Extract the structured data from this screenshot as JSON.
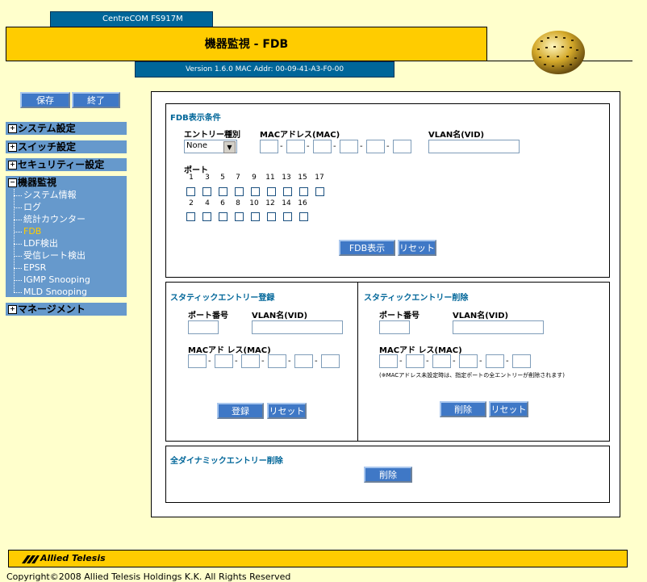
{
  "header": {
    "product_name": "CentreCOM FS917M",
    "page_title": "機器監視 - FDB",
    "version_info": "Version 1.6.0 MAC Addr: 00-09-41-A3-F0-00"
  },
  "toolbar": {
    "save_label": "保存",
    "exit_label": "終了"
  },
  "sidebar": {
    "system": "システム設定",
    "switch": "スイッチ設定",
    "security": "セキュリティー設定",
    "monitor": "機器監視",
    "monitor_items": [
      "システム情報",
      "ログ",
      "統計カウンター",
      "FDB",
      "LDF検出",
      "受信レート検出",
      "EPSR",
      "IGMP Snooping",
      "MLD Snooping"
    ],
    "management": "マネージメント",
    "expand_symbol": "+",
    "collapse_symbol": "−"
  },
  "fdb_filter": {
    "title": "FDB表示条件",
    "entry_type_label": "エントリー種別",
    "entry_type_value": "None",
    "mac_label": "MACアドレス(MAC)",
    "mac_separator": "-",
    "vlan_label": "VLAN名(VID)",
    "port_label": "ポート",
    "ports_odd": [
      "1",
      "3",
      "5",
      "7",
      "9",
      "11",
      "13",
      "15",
      "17"
    ],
    "ports_even": [
      "2",
      "4",
      "6",
      "8",
      "10",
      "12",
      "14",
      "16"
    ],
    "show_button": "FDB表示",
    "reset_button": "リセット"
  },
  "static_add": {
    "title": "スタティックエントリー登録",
    "port_label": "ポート番号",
    "vlan_label": "VLAN名(VID)",
    "mac_label": "MACアド レス(MAC)",
    "register_button": "登録",
    "reset_button": "リセット"
  },
  "static_delete": {
    "title": "スタティックエントリー削除",
    "port_label": "ポート番号",
    "vlan_label": "VLAN名(VID)",
    "mac_label": "MACアド レス(MAC)",
    "note": "(※MACアドレス未設定時は、指定ポートの全エントリーが削除されます)",
    "delete_button": "削除",
    "reset_button": "リセット"
  },
  "dynamic_delete": {
    "title": "全ダイナミックエントリー削除",
    "delete_button": "削除"
  },
  "footer": {
    "brand": "Allied Telesis",
    "copyright": "Copyright©2008 Allied Telesis Holdings K.K. All Rights Reserved"
  },
  "colors": {
    "accent_yellow": "#FFCC00",
    "header_blue": "#006699",
    "nav_blue": "#6699CC",
    "button_blue": "#3F78C6",
    "page_bg": "#FFFFCC"
  }
}
